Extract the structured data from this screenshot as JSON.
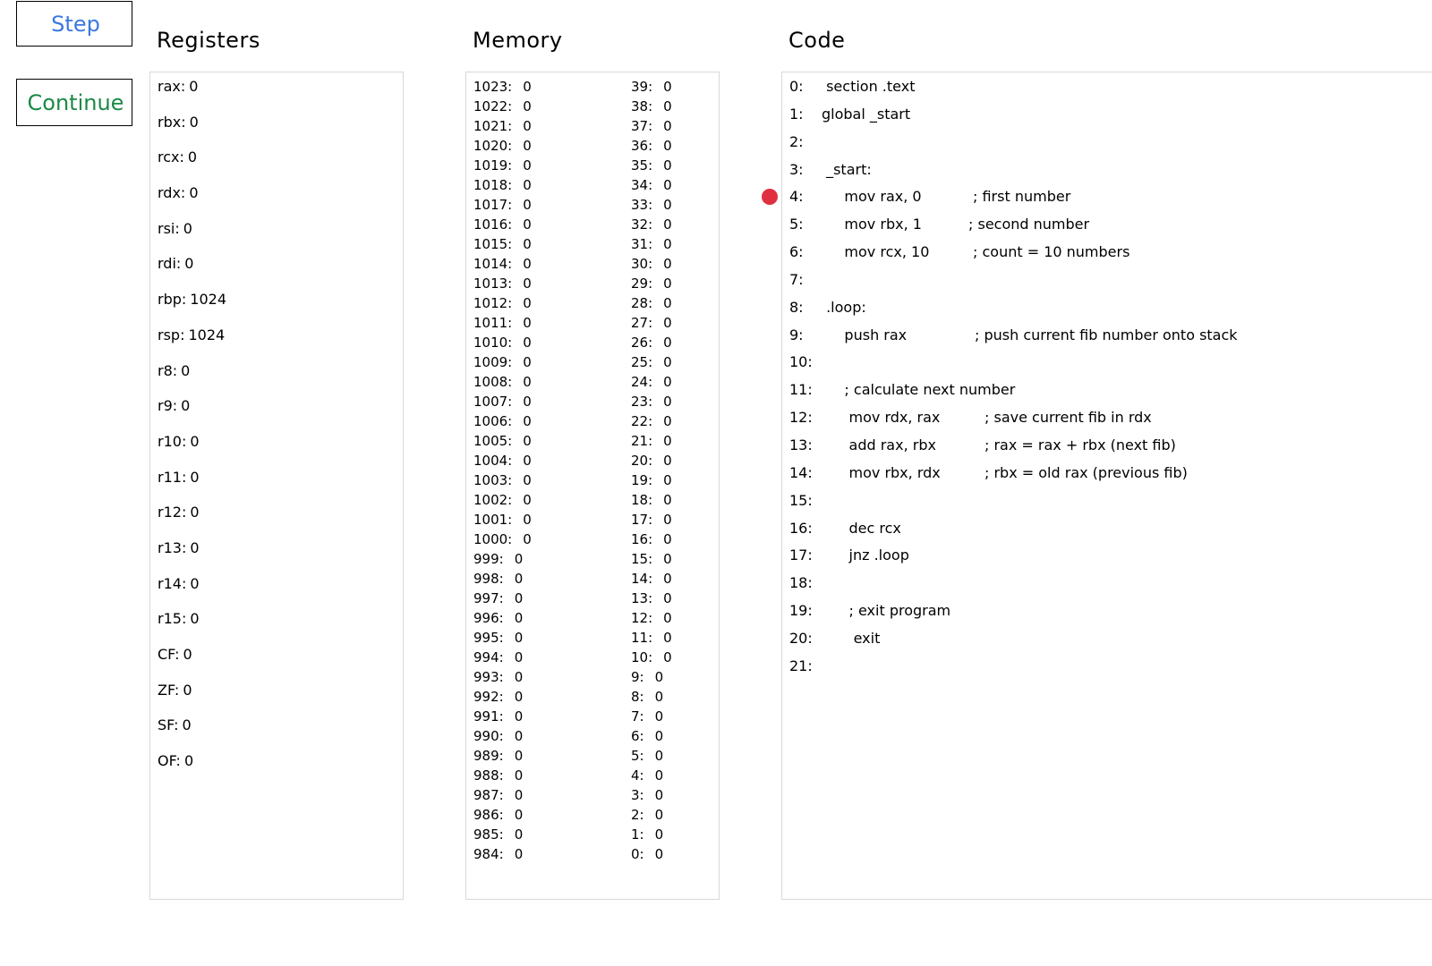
{
  "controls": {
    "step_label": "Step",
    "continue_label": "Continue",
    "step_color": "#3b78e0",
    "continue_color": "#1a8a45"
  },
  "registers": {
    "title": "Registers",
    "items": [
      {
        "name": "rax:",
        "value": "0"
      },
      {
        "name": "rbx:",
        "value": "0"
      },
      {
        "name": "rcx:",
        "value": "0"
      },
      {
        "name": "rdx:",
        "value": "0"
      },
      {
        "name": "rsi:",
        "value": "0"
      },
      {
        "name": "rdi:",
        "value": "0"
      },
      {
        "name": "rbp:",
        "value": "1024"
      },
      {
        "name": "rsp:",
        "value": "1024"
      },
      {
        "name": "r8:",
        "value": "0"
      },
      {
        "name": "r9:",
        "value": "0"
      },
      {
        "name": "r10:",
        "value": "0"
      },
      {
        "name": "r11:",
        "value": "0"
      },
      {
        "name": "r12:",
        "value": "0"
      },
      {
        "name": "r13:",
        "value": "0"
      },
      {
        "name": "r14:",
        "value": "0"
      },
      {
        "name": "r15:",
        "value": "0"
      },
      {
        "name": "CF:",
        "value": "0"
      },
      {
        "name": "ZF:",
        "value": "0"
      },
      {
        "name": "SF:",
        "value": "0"
      },
      {
        "name": "OF:",
        "value": "0"
      }
    ]
  },
  "memory": {
    "title": "Memory",
    "left": [
      {
        "addr": "1023:",
        "value": "0"
      },
      {
        "addr": "1022:",
        "value": "0"
      },
      {
        "addr": "1021:",
        "value": "0"
      },
      {
        "addr": "1020:",
        "value": "0"
      },
      {
        "addr": "1019:",
        "value": "0"
      },
      {
        "addr": "1018:",
        "value": "0"
      },
      {
        "addr": "1017:",
        "value": "0"
      },
      {
        "addr": "1016:",
        "value": "0"
      },
      {
        "addr": "1015:",
        "value": "0"
      },
      {
        "addr": "1014:",
        "value": "0"
      },
      {
        "addr": "1013:",
        "value": "0"
      },
      {
        "addr": "1012:",
        "value": "0"
      },
      {
        "addr": "1011:",
        "value": "0"
      },
      {
        "addr": "1010:",
        "value": "0"
      },
      {
        "addr": "1009:",
        "value": "0"
      },
      {
        "addr": "1008:",
        "value": "0"
      },
      {
        "addr": "1007:",
        "value": "0"
      },
      {
        "addr": "1006:",
        "value": "0"
      },
      {
        "addr": "1005:",
        "value": "0"
      },
      {
        "addr": "1004:",
        "value": "0"
      },
      {
        "addr": "1003:",
        "value": "0"
      },
      {
        "addr": "1002:",
        "value": "0"
      },
      {
        "addr": "1001:",
        "value": "0"
      },
      {
        "addr": "1000:",
        "value": "0"
      },
      {
        "addr": "999:",
        "value": "0"
      },
      {
        "addr": "998:",
        "value": "0"
      },
      {
        "addr": "997:",
        "value": "0"
      },
      {
        "addr": "996:",
        "value": "0"
      },
      {
        "addr": "995:",
        "value": "0"
      },
      {
        "addr": "994:",
        "value": "0"
      },
      {
        "addr": "993:",
        "value": "0"
      },
      {
        "addr": "992:",
        "value": "0"
      },
      {
        "addr": "991:",
        "value": "0"
      },
      {
        "addr": "990:",
        "value": "0"
      },
      {
        "addr": "989:",
        "value": "0"
      },
      {
        "addr": "988:",
        "value": "0"
      },
      {
        "addr": "987:",
        "value": "0"
      },
      {
        "addr": "986:",
        "value": "0"
      },
      {
        "addr": "985:",
        "value": "0"
      },
      {
        "addr": "984:",
        "value": "0"
      }
    ],
    "right": [
      {
        "addr": "39:",
        "value": "0"
      },
      {
        "addr": "38:",
        "value": "0"
      },
      {
        "addr": "37:",
        "value": "0"
      },
      {
        "addr": "36:",
        "value": "0"
      },
      {
        "addr": "35:",
        "value": "0"
      },
      {
        "addr": "34:",
        "value": "0"
      },
      {
        "addr": "33:",
        "value": "0"
      },
      {
        "addr": "32:",
        "value": "0"
      },
      {
        "addr": "31:",
        "value": "0"
      },
      {
        "addr": "30:",
        "value": "0"
      },
      {
        "addr": "29:",
        "value": "0"
      },
      {
        "addr": "28:",
        "value": "0"
      },
      {
        "addr": "27:",
        "value": "0"
      },
      {
        "addr": "26:",
        "value": "0"
      },
      {
        "addr": "25:",
        "value": "0"
      },
      {
        "addr": "24:",
        "value": "0"
      },
      {
        "addr": "23:",
        "value": "0"
      },
      {
        "addr": "22:",
        "value": "0"
      },
      {
        "addr": "21:",
        "value": "0"
      },
      {
        "addr": "20:",
        "value": "0"
      },
      {
        "addr": "19:",
        "value": "0"
      },
      {
        "addr": "18:",
        "value": "0"
      },
      {
        "addr": "17:",
        "value": "0"
      },
      {
        "addr": "16:",
        "value": "0"
      },
      {
        "addr": "15:",
        "value": "0"
      },
      {
        "addr": "14:",
        "value": "0"
      },
      {
        "addr": "13:",
        "value": "0"
      },
      {
        "addr": "12:",
        "value": "0"
      },
      {
        "addr": "11:",
        "value": "0"
      },
      {
        "addr": "10:",
        "value": "0"
      },
      {
        "addr": "9:",
        "value": "0"
      },
      {
        "addr": "8:",
        "value": "0"
      },
      {
        "addr": "7:",
        "value": "0"
      },
      {
        "addr": "6:",
        "value": "0"
      },
      {
        "addr": "5:",
        "value": "0"
      },
      {
        "addr": "4:",
        "value": "0"
      },
      {
        "addr": "3:",
        "value": "0"
      },
      {
        "addr": "2:",
        "value": "0"
      },
      {
        "addr": "1:",
        "value": "0"
      },
      {
        "addr": "0:",
        "value": "0"
      }
    ]
  },
  "code": {
    "title": "Code",
    "breakpoint_color": "#e03040",
    "lines": [
      {
        "ln": "0:",
        "text": " section .text",
        "comment": ""
      },
      {
        "ln": "1:",
        "text": "global _start",
        "comment": ""
      },
      {
        "ln": "2:",
        "text": "",
        "comment": ""
      },
      {
        "ln": "3:",
        "text": " _start:",
        "comment": ""
      },
      {
        "ln": "4:",
        "text": "     mov rax, 0",
        "comment": "; first number"
      },
      {
        "ln": "5:",
        "text": "     mov rbx, 1",
        "comment": "; second number"
      },
      {
        "ln": "6:",
        "text": "     mov rcx, 10",
        "comment": "; count = 10 numbers"
      },
      {
        "ln": "7:",
        "text": "",
        "comment": ""
      },
      {
        "ln": "8:",
        "text": " .loop:",
        "comment": ""
      },
      {
        "ln": "9:",
        "text": "     push rax",
        "comment": "; push current fib number onto stack"
      },
      {
        "ln": "10:",
        "text": "",
        "comment": ""
      },
      {
        "ln": "11:",
        "text": "     ; calculate next number",
        "comment": ""
      },
      {
        "ln": "12:",
        "text": "      mov rdx, rax",
        "comment": "; save current fib in rdx"
      },
      {
        "ln": "13:",
        "text": "      add rax, rbx",
        "comment": "; rax = rax + rbx (next fib)"
      },
      {
        "ln": "14:",
        "text": "      mov rbx, rdx",
        "comment": "; rbx = old rax (previous fib)"
      },
      {
        "ln": "15:",
        "text": "",
        "comment": ""
      },
      {
        "ln": "16:",
        "text": "      dec rcx",
        "comment": ""
      },
      {
        "ln": "17:",
        "text": "      jnz .loop",
        "comment": ""
      },
      {
        "ln": "18:",
        "text": "",
        "comment": ""
      },
      {
        "ln": "19:",
        "text": "      ; exit program",
        "comment": ""
      },
      {
        "ln": "20:",
        "text": "       exit",
        "comment": ""
      },
      {
        "ln": "21:",
        "text": "",
        "comment": ""
      }
    ]
  }
}
